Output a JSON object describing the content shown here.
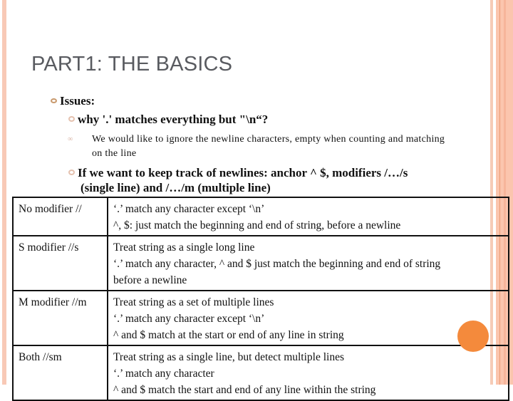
{
  "slide": {
    "title": "PART1: THE BASICS",
    "bullets": {
      "level1": "Issues:",
      "level2_a": "why '.' matches everything but \"\\n“?",
      "level3": "We would like to ignore the newline characters, empty when counting and matching on the line",
      "level2_b": "If we want to keep track of newlines: anchor ^ $, modifiers /…/s (single line) and /…/m (multiple line)"
    },
    "table": {
      "rows": [
        {
          "modifier": "No modifier //",
          "lines": [
            "‘.’ match any character except ‘\\n’",
            "^, $: just match the beginning and end of string, before a newline"
          ]
        },
        {
          "modifier": "S modifier //s",
          "lines": [
            "Treat string as a single long line",
            "‘.’ match any character, ^ and $ just match the beginning and end of string",
            "before a newline"
          ]
        },
        {
          "modifier": "M modifier //m",
          "lines": [
            "Treat string as a set of multiple lines",
            "‘.’ match any character except ‘\\n’",
            "^ and $ match at the start or end of any line in string"
          ]
        },
        {
          "modifier": "Both //sm",
          "lines": [
            "Treat string as a single line, but detect multiple lines",
            "‘.’ match any character",
            "^ and $ match the start and end of any line within the string"
          ]
        }
      ]
    },
    "colors": {
      "accent_circle": "#f48a3c",
      "stripe": "#fbc5ae",
      "title_text": "#595b60"
    }
  }
}
